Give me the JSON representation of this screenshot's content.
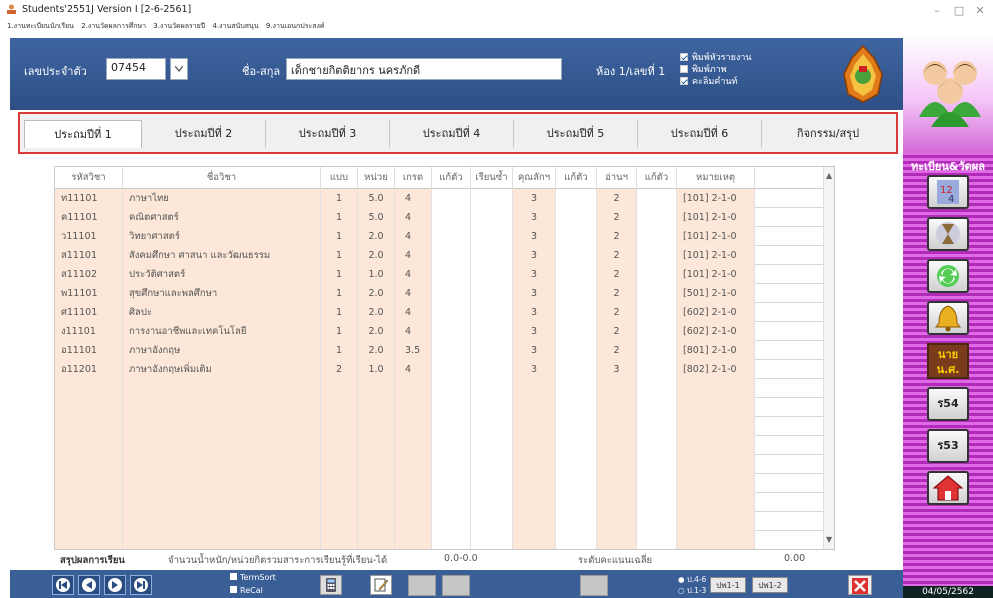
{
  "window": {
    "title": "Students'2551J Version I [2-6-2561]",
    "controls": [
      "–",
      "□",
      "✕"
    ]
  },
  "menu": [
    "1.งานทะเบียนนักเรียน",
    "2.งานวัดผลการศึกษา",
    "3.งานวัดผลรายปี",
    "4.งานสนับสนุน",
    "9.งานเอนกประสงค์"
  ],
  "header": {
    "id_label": "เลขประจำตัว",
    "id_value": "07454",
    "name_label": "ชื่อ-สกุล",
    "name_value": "เด็กชายกิตติยากร นครภักดี",
    "room": "ห้อง 1/เลขที่ 1",
    "options": [
      {
        "label": "พิมพ์หัวรายงาน",
        "checked": true
      },
      {
        "label": "พิมพ์ภาพ",
        "checked": false
      },
      {
        "label": "คะลิมคำนท์",
        "checked": true
      }
    ]
  },
  "tabs": [
    "ประถมปีที่ 1",
    "ประถมปีที่ 2",
    "ประถมปีที่ 3",
    "ประถมปีที่ 4",
    "ประถมปีที่ 5",
    "ประถมปีที่ 6",
    "กิจกรรม/สรุป"
  ],
  "table": {
    "columns": [
      "รหัสวิชา",
      "ชื่อวิชา",
      "แบบ",
      "หน่วย",
      "เกรด",
      "แก้ตัว",
      "เรียนซ้ำ",
      "คุณลักฯ",
      "แก้ตัว",
      "อ่านฯ",
      "แก้ตัว",
      "หมายเหตุ"
    ],
    "rows": [
      [
        "ท11101",
        "ภาษาไทย",
        "1",
        "5.0",
        "4",
        "",
        "",
        "3",
        "",
        "2",
        "",
        "[101] 2-1-0"
      ],
      [
        "ค11101",
        "คณิตศาสตร์",
        "1",
        "5.0",
        "4",
        "",
        "",
        "3",
        "",
        "2",
        "",
        "[101] 2-1-0"
      ],
      [
        "ว11101",
        "วิทยาศาสตร์",
        "1",
        "2.0",
        "4",
        "",
        "",
        "3",
        "",
        "2",
        "",
        "[101] 2-1-0"
      ],
      [
        "ส11101",
        "สังคมศึกษา ศาสนา และวัฒนธรรม",
        "1",
        "2.0",
        "4",
        "",
        "",
        "3",
        "",
        "2",
        "",
        "[101] 2-1-0"
      ],
      [
        "ส11102",
        "ประวัติศาสตร์",
        "1",
        "1.0",
        "4",
        "",
        "",
        "3",
        "",
        "2",
        "",
        "[101] 2-1-0"
      ],
      [
        "พ11101",
        "สุขศึกษาและพลศึกษา",
        "1",
        "2.0",
        "4",
        "",
        "",
        "3",
        "",
        "2",
        "",
        "[501] 2-1-0"
      ],
      [
        "ศ11101",
        "ศิลปะ",
        "1",
        "2.0",
        "4",
        "",
        "",
        "3",
        "",
        "2",
        "",
        "[602] 2-1-0"
      ],
      [
        "ง11101",
        "การงานอาชีพและเทคโนโลยี",
        "1",
        "2.0",
        "4",
        "",
        "",
        "3",
        "",
        "2",
        "",
        "[602] 2-1-0"
      ],
      [
        "อ11101",
        "ภาษาอังกฤษ",
        "1",
        "2.0",
        "3.5",
        "",
        "",
        "3",
        "",
        "2",
        "",
        "[801] 2-1-0"
      ],
      [
        "อ11201",
        "ภาษาอังกฤษเพิ่มเติม",
        "2",
        "1.0",
        "4",
        "",
        "",
        "3",
        "",
        "3",
        "",
        "[802] 2-1-0"
      ]
    ]
  },
  "summary": {
    "label": "สรุปผลการเรียน",
    "desc": "จำนวนน้ำหนัก/หน่วยกิตรวมสาระการเรียนรู้ที่เรียน-ได้",
    "credits": "0.0-0.0",
    "gpa_label": "ระดับคะแนนเฉลี่ย",
    "gpa": "0.00"
  },
  "sidebar": {
    "caption": "ทะเบียน&วัดผล",
    "nay": "นาย น.ศ.",
    "btn_554": "ร54",
    "btn_553": "ร53",
    "date": "04/05/2562"
  },
  "bottom": {
    "termsort": "TermSort",
    "recal": "ReCal",
    "radio1": "ป.4-6",
    "radio2": "ป.1-3",
    "p_btn1": "ปพ1-1",
    "p_btn2": "ปพ1-2"
  },
  "colors": {
    "header_bg": "#2d4f86",
    "sidebar_stripe": "#b02cb8",
    "tab_border": "#d83a3a",
    "row_peach": "#fce7d9"
  }
}
